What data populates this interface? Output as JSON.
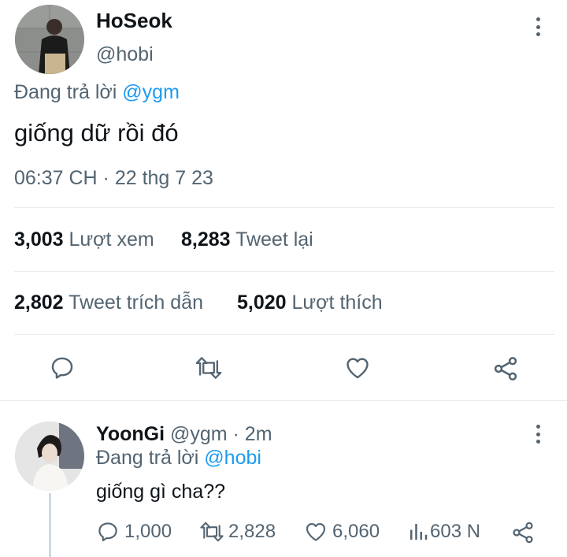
{
  "main_tweet": {
    "name": "HoSeok",
    "handle": "@hobi",
    "replying_prefix": "Đang trả lời",
    "replying_to": "@ygm",
    "text": "giống dữ rồi đó",
    "timestamp": "06:37 CH · 22 thg 7 23",
    "stats": {
      "views_count": "3,003",
      "views_label": "Lượt xem",
      "retweets_count": "8,283",
      "retweets_label": "Tweet lại",
      "quotes_count": "2,802",
      "quotes_label": "Tweet trích dẫn",
      "likes_count": "5,020",
      "likes_label": "Lượt thích"
    },
    "actions": [
      "reply-icon",
      "retweet-icon",
      "like-icon",
      "share-icon"
    ]
  },
  "reply_tweet": {
    "name": "YoonGi",
    "handle_time": "@ygm · 2m",
    "replying_prefix": "Đang trả lời",
    "replying_to": "@hobi",
    "text": "giống gì cha??",
    "actions": {
      "reply_count": "1,000",
      "retweet_count": "2,828",
      "like_count": "6,060",
      "views_count": "603 N"
    }
  },
  "colors": {
    "link": "#1d9bf0",
    "secondary_text": "#536471",
    "primary_text": "#0f1419",
    "divider": "#e6ecf0"
  }
}
